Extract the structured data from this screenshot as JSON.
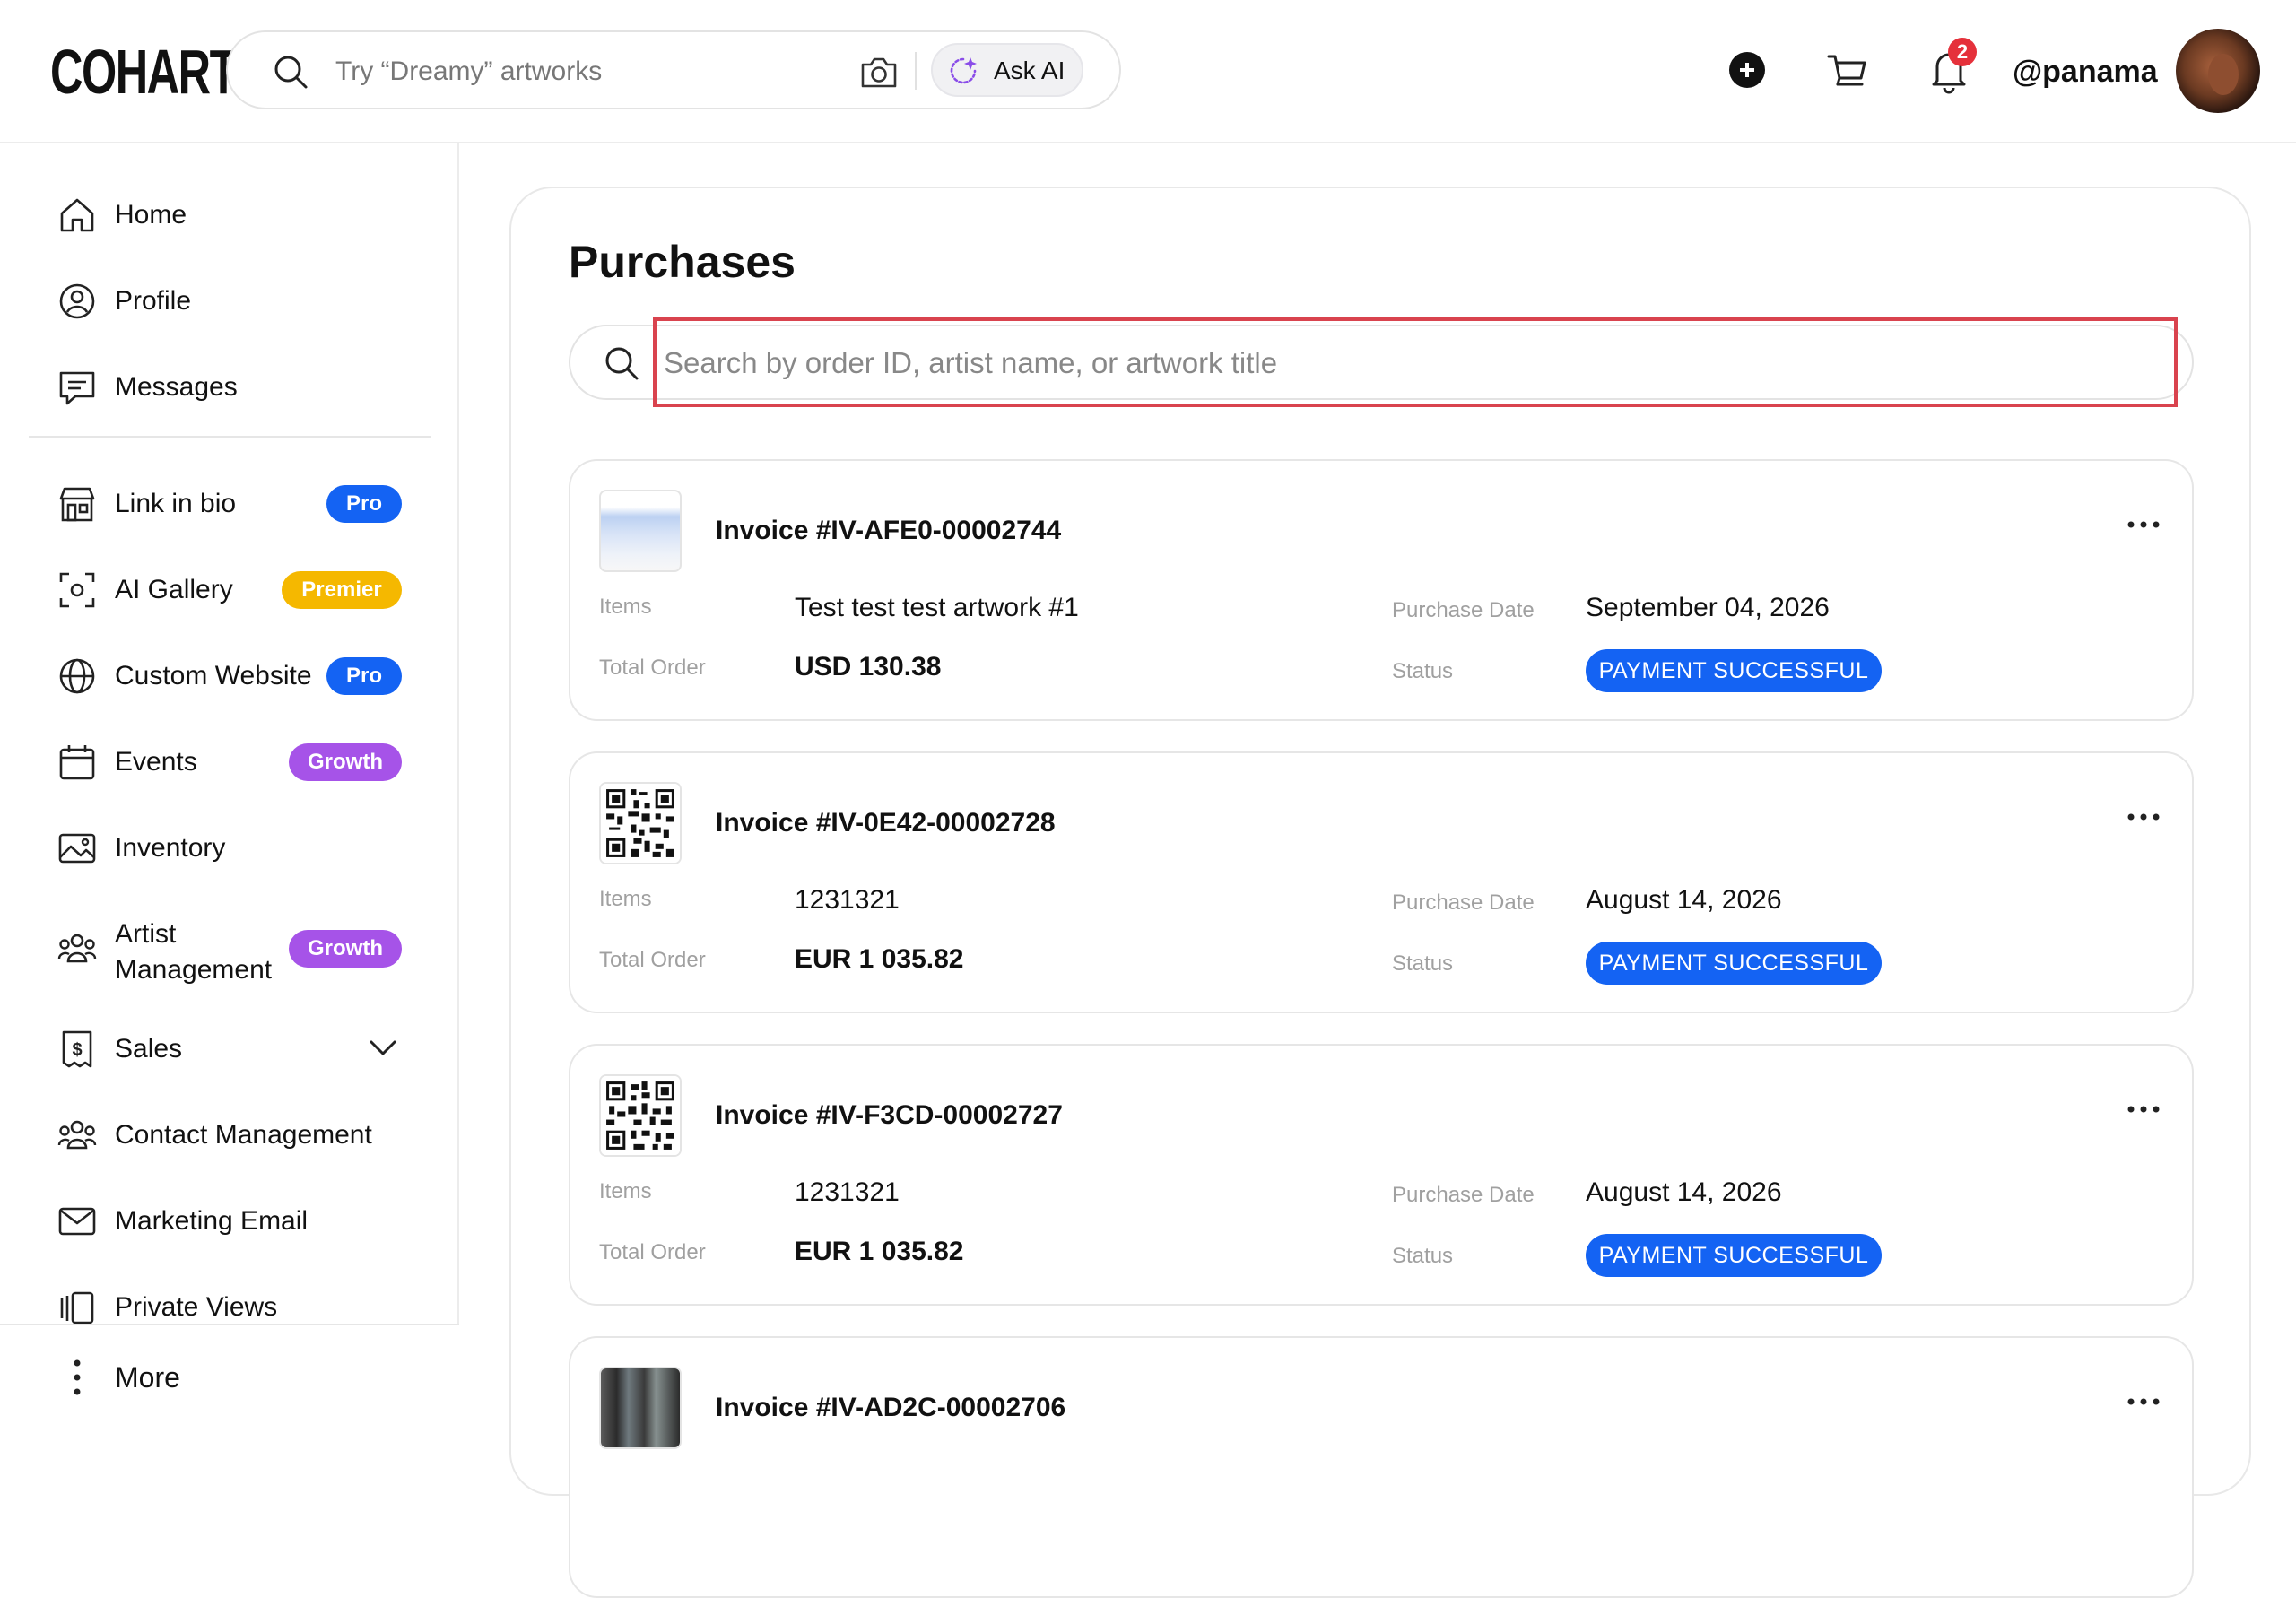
{
  "header": {
    "logo": "COHART",
    "search_placeholder": "Try “Dreamy” artworks",
    "ask_ai_label": "Ask AI",
    "notification_count": "2",
    "username": "@panama"
  },
  "sidebar": {
    "items": [
      {
        "label": "Home",
        "icon": "home-icon"
      },
      {
        "label": "Profile",
        "icon": "profile-icon"
      },
      {
        "label": "Messages",
        "icon": "messages-icon"
      },
      {
        "label": "Link in bio",
        "icon": "store-icon",
        "badge": "Pro"
      },
      {
        "label": "AI Gallery",
        "icon": "ai-scan-icon",
        "badge": "Premier"
      },
      {
        "label": "Custom Website",
        "icon": "globe-icon",
        "badge": "Pro"
      },
      {
        "label": "Events",
        "icon": "calendar-icon",
        "badge": "Growth"
      },
      {
        "label": "Inventory",
        "icon": "image-icon"
      },
      {
        "label": "Artist Management",
        "icon": "people-icon",
        "badge": "Growth"
      },
      {
        "label": "Sales",
        "icon": "dollar-doc-icon"
      },
      {
        "label": "Contact Management",
        "icon": "contacts-icon"
      },
      {
        "label": "Marketing Email",
        "icon": "mail-icon"
      },
      {
        "label": "Private Views",
        "icon": "views-icon"
      }
    ],
    "more_label": "More"
  },
  "main": {
    "title": "Purchases",
    "search_placeholder": "Search by order ID, artist name, or artwork title",
    "labels": {
      "items": "Items",
      "total_order": "Total Order",
      "purchase_date": "Purchase Date",
      "status": "Status"
    },
    "invoices": [
      {
        "title": "Invoice #IV-AFE0-00002744",
        "items": "Test test test artwork #1",
        "total": "USD 130.38",
        "date": "September 04, 2026",
        "status": "PAYMENT SUCCESSFUL"
      },
      {
        "title": "Invoice #IV-0E42-00002728",
        "items": "1231321",
        "total": "EUR 1 035.82",
        "date": "August 14, 2026",
        "status": "PAYMENT SUCCESSFUL"
      },
      {
        "title": "Invoice #IV-F3CD-00002727",
        "items": "1231321",
        "total": "EUR 1 035.82",
        "date": "August 14, 2026",
        "status": "PAYMENT SUCCESSFUL"
      },
      {
        "title": "Invoice #IV-AD2C-00002706"
      }
    ]
  },
  "colors": {
    "accent_blue": "#1463f3",
    "premier_yellow": "#f5b800",
    "growth_purple": "#a653e8",
    "badge_red": "#e5313b",
    "focus_red": "#d9434e"
  }
}
